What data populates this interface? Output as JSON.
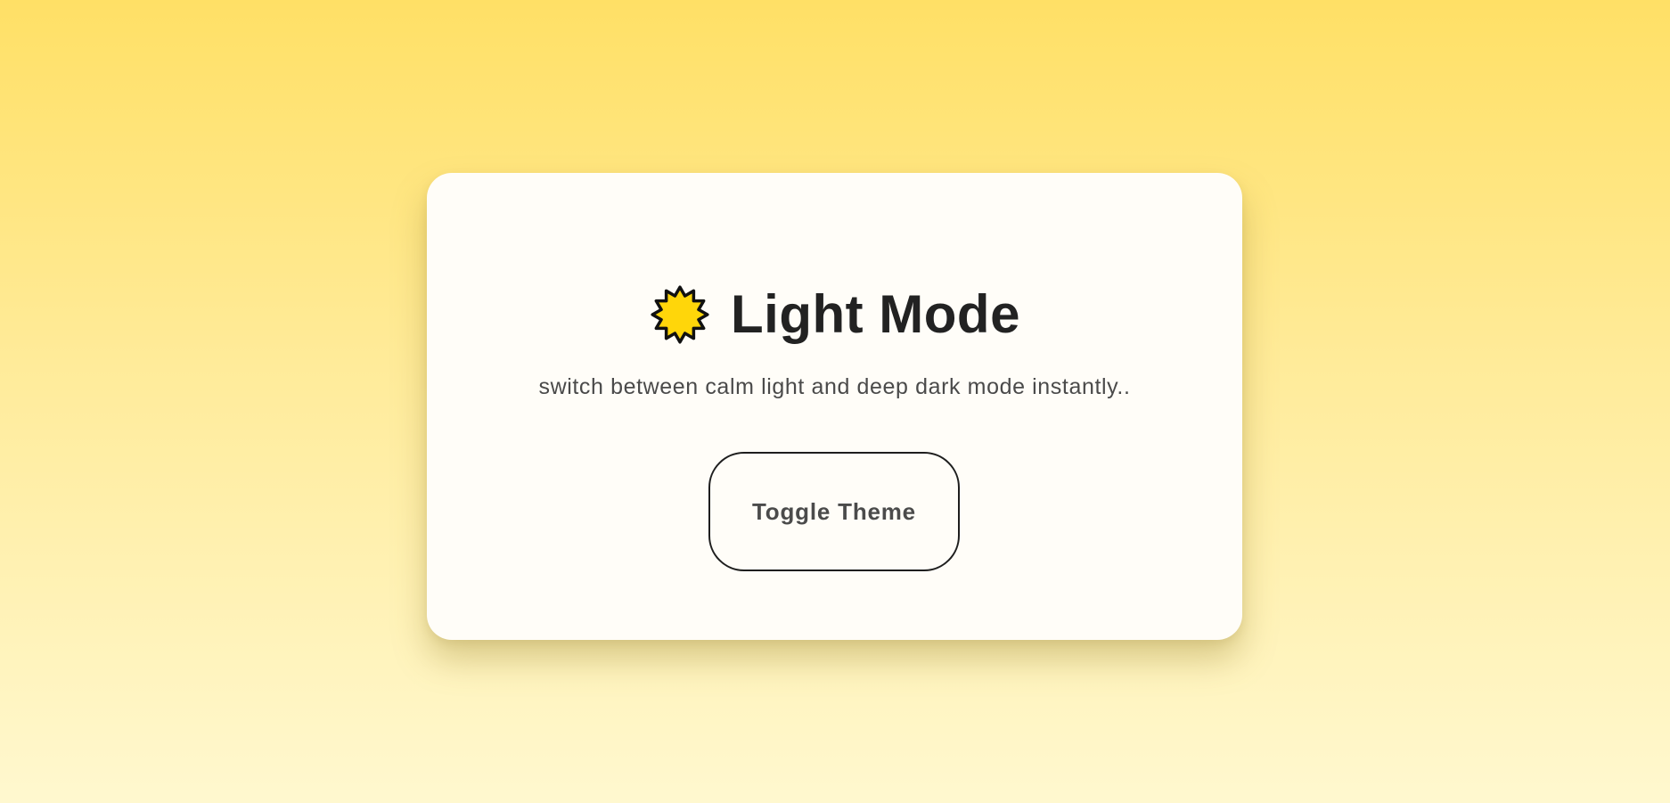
{
  "card": {
    "icon": "sun-icon",
    "title": "Light Mode",
    "subtitle": "switch between calm light and deep dark mode instantly..",
    "toggle_button_label": "Toggle Theme"
  },
  "colors": {
    "background_top": "#ffe066",
    "background_bottom": "#fff8cf",
    "card_background": "#fffdf8",
    "title_text": "#222222",
    "subtitle_text": "#4a4a4a",
    "button_border": "#1e1e1e",
    "sun_fill": "#ffd60a"
  }
}
